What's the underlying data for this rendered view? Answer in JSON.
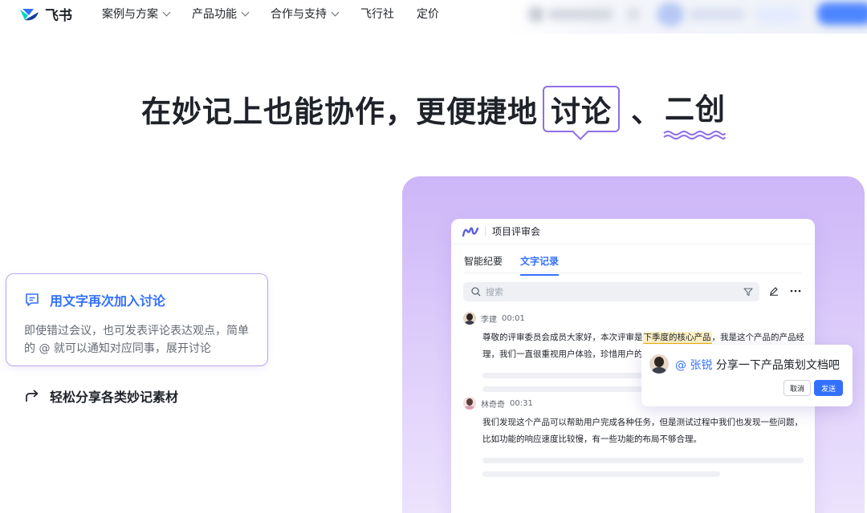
{
  "nav": {
    "brand": "飞书",
    "items": [
      {
        "label": "案例与方案",
        "dropdown": true
      },
      {
        "label": "产品功能",
        "dropdown": true
      },
      {
        "label": "合作与支持",
        "dropdown": true
      },
      {
        "label": "飞行社",
        "dropdown": false
      },
      {
        "label": "定价",
        "dropdown": false
      }
    ]
  },
  "headline": {
    "prefix": "在妙记上也能协作，更便捷地",
    "boxed": "讨论",
    "separator": "、",
    "underlined": "二创"
  },
  "features": [
    {
      "title": "用文字再次加入讨论",
      "description": "即使错过会议，也可发表评论表达观点，简单的 @ 就可以通知对应同事，展开讨论",
      "icon": "comment-icon"
    },
    {
      "title": "轻松分享各类妙记素材",
      "icon": "share-icon"
    }
  ],
  "app": {
    "title": "项目评审会",
    "tabs": [
      {
        "label": "智能纪要",
        "active": false
      },
      {
        "label": "文字记录",
        "active": true
      }
    ],
    "search_placeholder": "搜索",
    "messages": [
      {
        "speaker": "李建",
        "time": "00:01",
        "text_before": "尊敬的评审委员会成员大家好，本次评审是",
        "highlight": "下季度的核心产品",
        "text_after": "，我是这个产品的产品经理，我们一直很重视用户体验，珍惜用户的"
      },
      {
        "speaker": "林奇奇",
        "time": "00:31",
        "text": "我们发现这个产品可以帮助用户完成各种任务，但是测试过程中我们也发现一些问题，比如功能的响应速度比较慢，有一些功能的布局不够合理。"
      }
    ]
  },
  "popup": {
    "mention": "@ 张锐",
    "text": " 分享一下产品策划文档吧",
    "cancel_label": "取消",
    "send_label": "发送"
  },
  "colors": {
    "accent": "#3370ff",
    "purple": "#8e6ee8",
    "highlight": "#fdf1c4"
  }
}
